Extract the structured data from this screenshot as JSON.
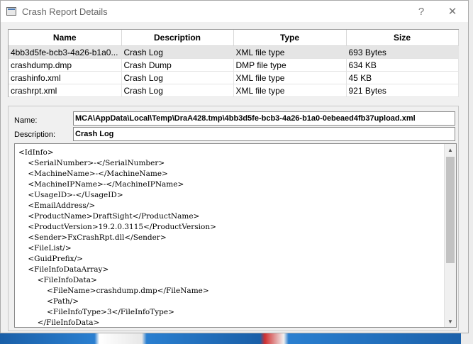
{
  "window": {
    "title": "Crash Report Details",
    "help_glyph": "?",
    "close_glyph": "✕"
  },
  "files": {
    "columns": [
      "Name",
      "Description",
      "Type",
      "Size"
    ],
    "rows": [
      [
        "4bb3d5fe-bcb3-4a26-b1a0...",
        "Crash Log",
        "XML file type",
        "693 Bytes"
      ],
      [
        "crashdump.dmp",
        "Crash Dump",
        "DMP file type",
        "634 KB"
      ],
      [
        "crashinfo.xml",
        "Crash Log",
        "XML file type",
        "45 KB"
      ],
      [
        "crashrpt.xml",
        "Crash Log",
        "XML file type",
        "921 Bytes"
      ]
    ],
    "selected_index": 0
  },
  "details": {
    "name_label": "Name:",
    "name_value": "MCA\\AppData\\Local\\Temp\\DraA428.tmp\\4bb3d5fe-bcb3-4a26-b1a0-0ebeaed4fb37upload.xml",
    "description_label": "Description:",
    "description_value": "Crash Log",
    "xml_lines": [
      "<IdInfo>",
      "    <SerialNumber>-</SerialNumber>",
      "    <MachineName>-</MachineName>",
      "    <MachineIPName>-</MachineIPName>",
      "    <UsageID>-</UsageID>",
      "    <EmailAddress/>",
      "    <ProductName>DraftSight</ProductName>",
      "    <ProductVersion>19.2.0.3115</ProductVersion>",
      "    <Sender>FxCrashRpt.dll</Sender>",
      "    <FileList/>",
      "    <GuidPrefix/>",
      "    <FileInfoDataArray>",
      "        <FileInfoData>",
      "            <FileName>crashdump.dmp</FileName>",
      "            <Path/>",
      "            <FileInfoType>3</FileInfoType>",
      "        </FileInfoData>"
    ]
  },
  "icons": {
    "app": "window-icon",
    "scroll_up": "chevron-up-icon",
    "scroll_down": "chevron-down-icon"
  }
}
